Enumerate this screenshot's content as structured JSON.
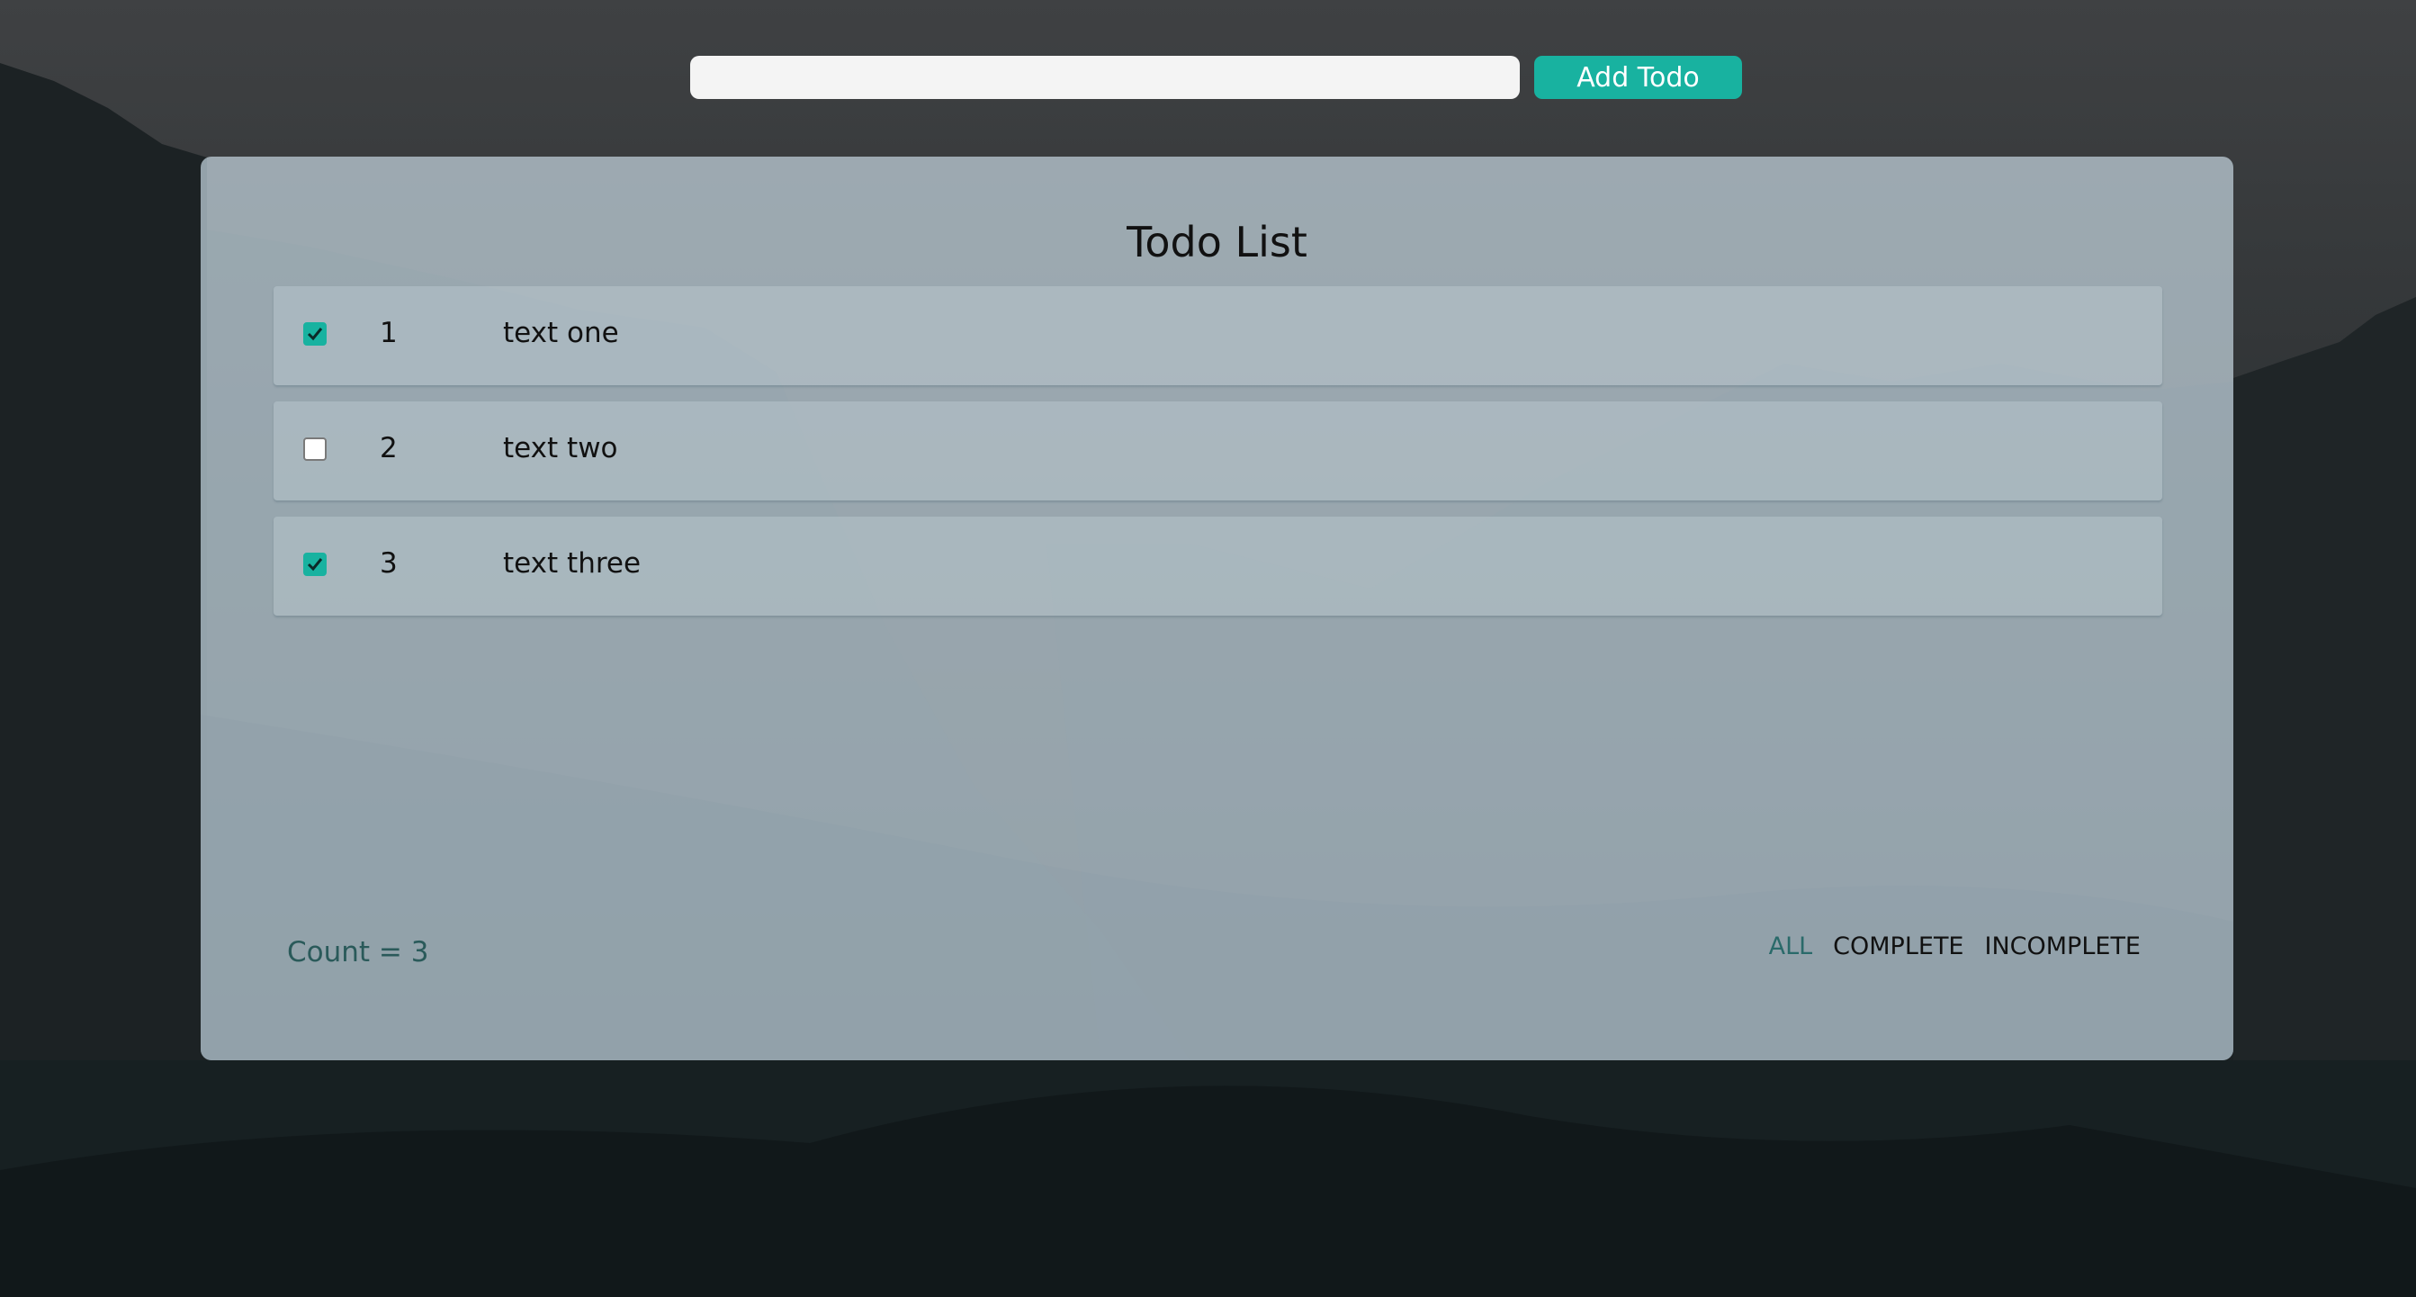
{
  "add_bar": {
    "input_value": "",
    "input_placeholder": "",
    "add_button_label": "Add Todo"
  },
  "card": {
    "title": "Todo List",
    "todos": [
      {
        "number": "1",
        "text": "text one",
        "checked": true
      },
      {
        "number": "2",
        "text": "text two",
        "checked": false
      },
      {
        "number": "3",
        "text": "text three",
        "checked": true
      }
    ],
    "count_label": "Count = 3",
    "filters": [
      {
        "label": "ALL",
        "active": true
      },
      {
        "label": "COMPLETE",
        "active": false
      },
      {
        "label": "INCOMPLETE",
        "active": false
      }
    ]
  },
  "colors": {
    "accent": "#18b2a0",
    "count_text": "#2a5a5a",
    "active_filter": "#2a6a6a"
  },
  "icons": {
    "checkbox_checked": "check-icon"
  }
}
